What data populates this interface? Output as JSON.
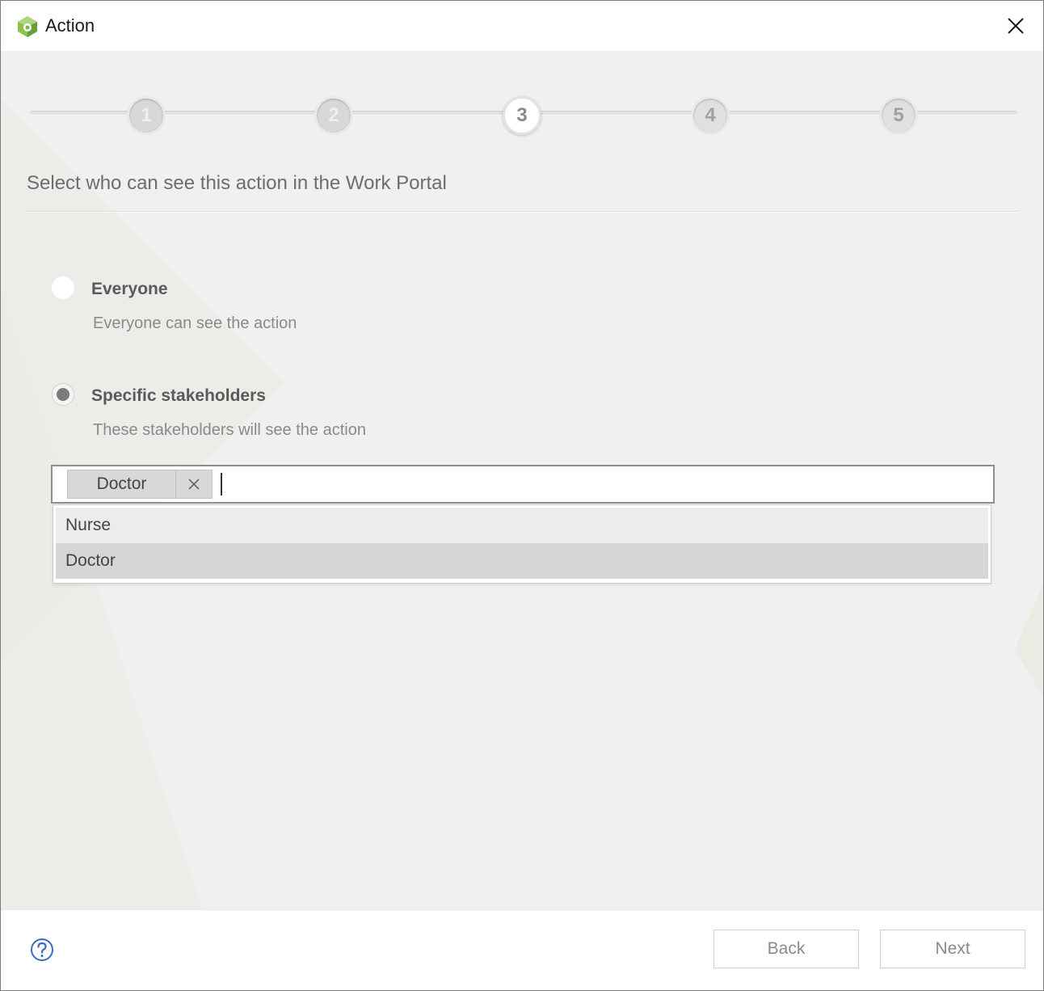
{
  "window": {
    "title": "Action",
    "icons": {
      "app": "app-logo-icon",
      "close": "close-icon"
    }
  },
  "stepper": {
    "steps": [
      "1",
      "2",
      "3",
      "4",
      "5"
    ],
    "current": 3
  },
  "heading": "Select who can see this action in the Work Portal",
  "options": {
    "everyone": {
      "title": "Everyone",
      "description": "Everyone can see the action",
      "selected": false
    },
    "specific": {
      "title": "Specific stakeholders",
      "description": "These stakeholders will see the action",
      "selected": true
    }
  },
  "stakeholders": {
    "selected_tags": [
      "Doctor"
    ],
    "input_value": "",
    "dropdown_items": [
      "Nurse",
      "Doctor"
    ],
    "highlighted_item": "Doctor"
  },
  "footer": {
    "back_label": "Back",
    "next_label": "Next",
    "help_icon": "help-circle-icon"
  },
  "colors": {
    "accent_green": "#7cb342",
    "content_bg": "#f0f0f0",
    "help_blue": "#3b6cc4"
  }
}
